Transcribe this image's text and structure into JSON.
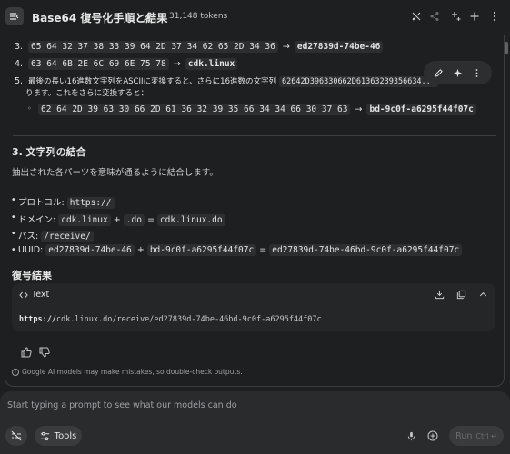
{
  "header": {
    "title": "Base64 復号化手順と結果",
    "tokens": "31,148 tokens"
  },
  "list": {
    "item3_num": "3.",
    "item3_hex": "65 64 32 37 38 33 39 64 2D 37 34 62 65 2D 34 36",
    "item3_result": "ed27839d-74be-46",
    "item4_num": "4.",
    "item4_hex": "63 64 6B 2E 6C 69 6E 75 78",
    "item4_result": "cdk.linux",
    "item5_num": "5.",
    "item5_text_a": "最後の長い16進数文字列をASCIIに変換すると、さらに16進数の文字列",
    "item5_code": "62642D396330662D61363239356634...",
    "item5_text_b": "ります。これをさらに変換すると：",
    "item5_sub_hex": "62 64 2D 39 63 30 66 2D 61 36 32 39 35 66 34 34 66 30 37 63",
    "item5_sub_result": "bd-9c0f-a6295f44f07c",
    "arrow": "→"
  },
  "section": {
    "heading": "3. 文字列の結合",
    "description": "抽出された各パーツを意味が通るように結合します。",
    "bullets": {
      "protocol_label": "プロトコル:",
      "protocol_value": "https://",
      "domain_label": "ドメイン:",
      "domain_part1": "cdk.linux",
      "plus": "+",
      "domain_part2": ".do",
      "equals": "=",
      "domain_result": "cdk.linux.do",
      "path_label": "パス:",
      "path_value": "/receive/",
      "uuid_label": "UUID:",
      "uuid_part1": "ed27839d-74be-46",
      "uuid_part2": "bd-9c0f-a6295f44f07c",
      "uuid_result": "ed27839d-74be-46bd-9c0f-a6295f44f07c"
    }
  },
  "result": {
    "heading": "復号結果",
    "code_label": "Text",
    "code_scheme": "https://",
    "code_rest": "cdk.linux.do/receive/ed27839d-74be-46bd-9c0f-a6295f44f07c"
  },
  "disclaimer": "Google AI models may make mistakes, so double-check outputs.",
  "prompt": {
    "placeholder": "Start typing a prompt to see what our models can do",
    "tools_label": "Tools",
    "run_label": "Run",
    "run_shortcut": "Ctrl ↵"
  },
  "icons": {
    "menu": "menu-icon",
    "edit": "edit-icon",
    "compare": "compare-icon",
    "share": "share-icon",
    "sparkle": "sparkle-icon",
    "add": "add-icon",
    "more": "more-icon"
  }
}
